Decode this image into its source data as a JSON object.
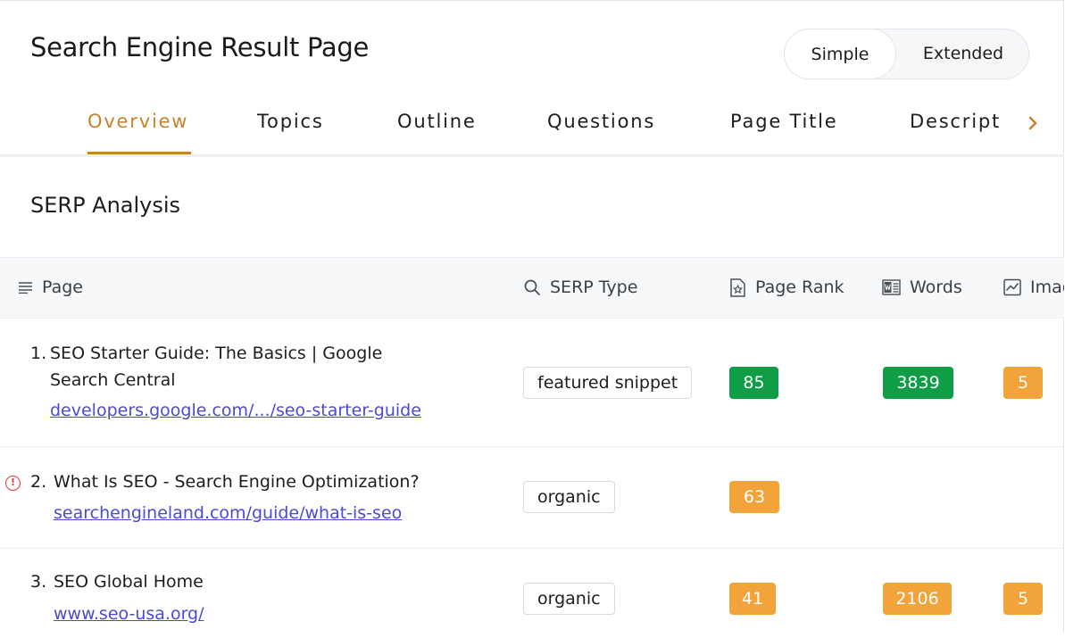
{
  "header": {
    "title": "Search Engine Result Page"
  },
  "view_toggle": {
    "options": [
      "Simple",
      "Extended"
    ],
    "selected": "Simple"
  },
  "tabs": [
    {
      "label": "Overview",
      "active": true
    },
    {
      "label": "Topics"
    },
    {
      "label": "Outline"
    },
    {
      "label": "Questions"
    },
    {
      "label": "Page Title"
    },
    {
      "label": "Descript"
    }
  ],
  "section": {
    "title": "SERP Analysis"
  },
  "table": {
    "columns": [
      "Page",
      "SERP Type",
      "Page Rank",
      "Words",
      "Imag"
    ],
    "rows": [
      {
        "num": "1.",
        "title": "SEO Starter Guide: The Basics | Google Search Central",
        "link": "developers.google.com/.../seo-starter-guide",
        "serp_type": "featured snippet",
        "page_rank": "85",
        "words": "3839",
        "images": "5"
      },
      {
        "num": "2.",
        "title": "What Is SEO - Search Engine Optimization?",
        "link": "searchengineland.com/guide/what-is-seo",
        "serp_type": "organic",
        "page_rank": "63",
        "warning": true
      },
      {
        "num": "3.",
        "title": "SEO Global Home",
        "link": "www.seo-usa.org/",
        "serp_type": "organic",
        "page_rank": "41",
        "words": "2106",
        "images": "5"
      }
    ]
  },
  "colors": {
    "accent": "#c9822a",
    "badge_green": "#0f9d46",
    "badge_orange": "#f2a43a",
    "link": "#4a4ad4",
    "warning": "#e0383e"
  }
}
